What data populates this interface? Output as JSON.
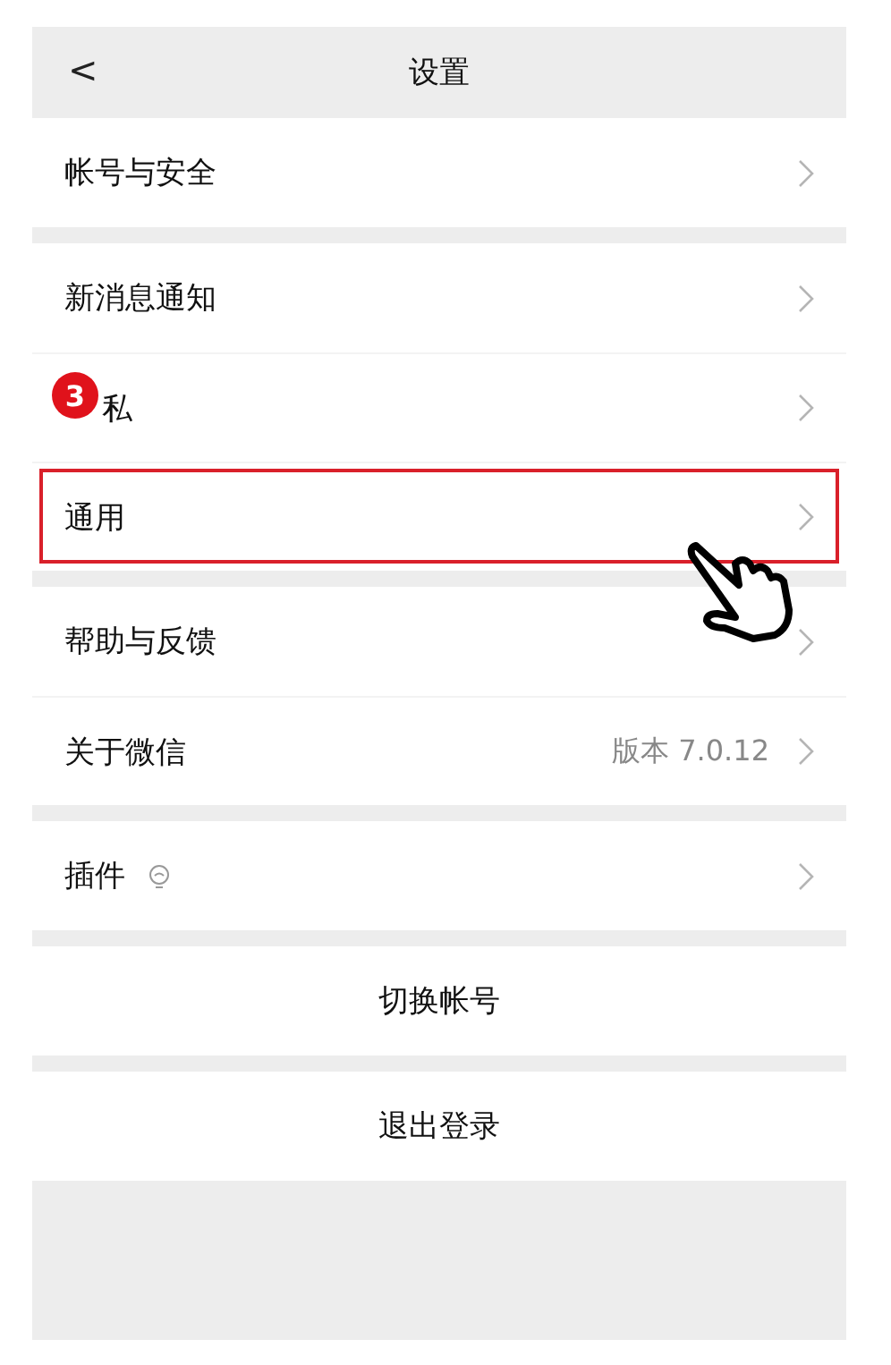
{
  "header": {
    "back": "<",
    "title": "设置"
  },
  "groups": [
    {
      "items": [
        {
          "kind": "nav",
          "label": "帐号与安全",
          "highlighted": false
        }
      ]
    },
    {
      "items": [
        {
          "kind": "nav",
          "label": "新消息通知",
          "highlighted": false
        },
        {
          "kind": "nav",
          "label": "私",
          "highlighted": false,
          "step_badge": "3"
        },
        {
          "kind": "nav",
          "label": "通用",
          "highlighted": true,
          "pointer": true
        }
      ]
    },
    {
      "items": [
        {
          "kind": "nav",
          "label": "帮助与反馈",
          "highlighted": false
        },
        {
          "kind": "nav",
          "label": "关于微信",
          "value": "版本 7.0.12",
          "highlighted": false
        }
      ]
    },
    {
      "items": [
        {
          "kind": "nav",
          "label": "插件",
          "bulb": true,
          "highlighted": false
        }
      ]
    },
    {
      "items": [
        {
          "kind": "action",
          "label": "切换帐号"
        }
      ]
    },
    {
      "items": [
        {
          "kind": "action",
          "label": "退出登录"
        }
      ]
    }
  ]
}
